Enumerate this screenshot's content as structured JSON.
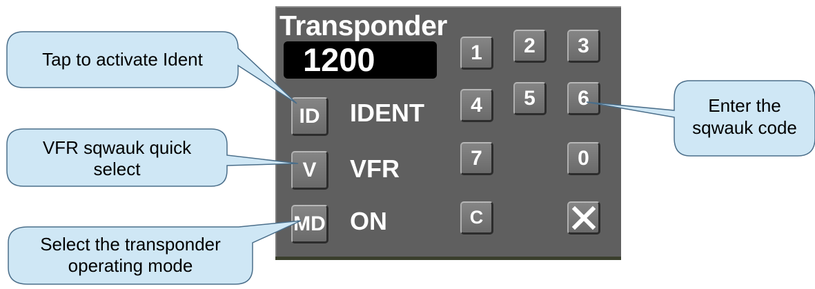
{
  "panel": {
    "title": "Transponder",
    "squawk": "1200",
    "ident_button": "ID",
    "ident_label": "IDENT",
    "vfr_button": "V",
    "vfr_label": "VFR",
    "mode_button": "MD",
    "mode_label": "ON",
    "keypad": {
      "k1": "1",
      "k2": "2",
      "k3": "3",
      "k4": "4",
      "k5": "5",
      "k6": "6",
      "k7": "7",
      "k0": "0",
      "clear": "C"
    },
    "close_icon": "close-icon"
  },
  "callouts": {
    "ident": "Tap to activate Ident",
    "vfr_line1": "VFR sqwauk quick",
    "vfr_line2": "select",
    "mode_line1": "Select the transponder",
    "mode_line2": "operating mode",
    "code_line1": "Enter the",
    "code_line2": "sqwauk code"
  },
  "colors": {
    "panel": "#5f5f5f",
    "button": "#777777",
    "callout_fill": "#cfe7f5",
    "callout_stroke": "#4a6e8a"
  }
}
